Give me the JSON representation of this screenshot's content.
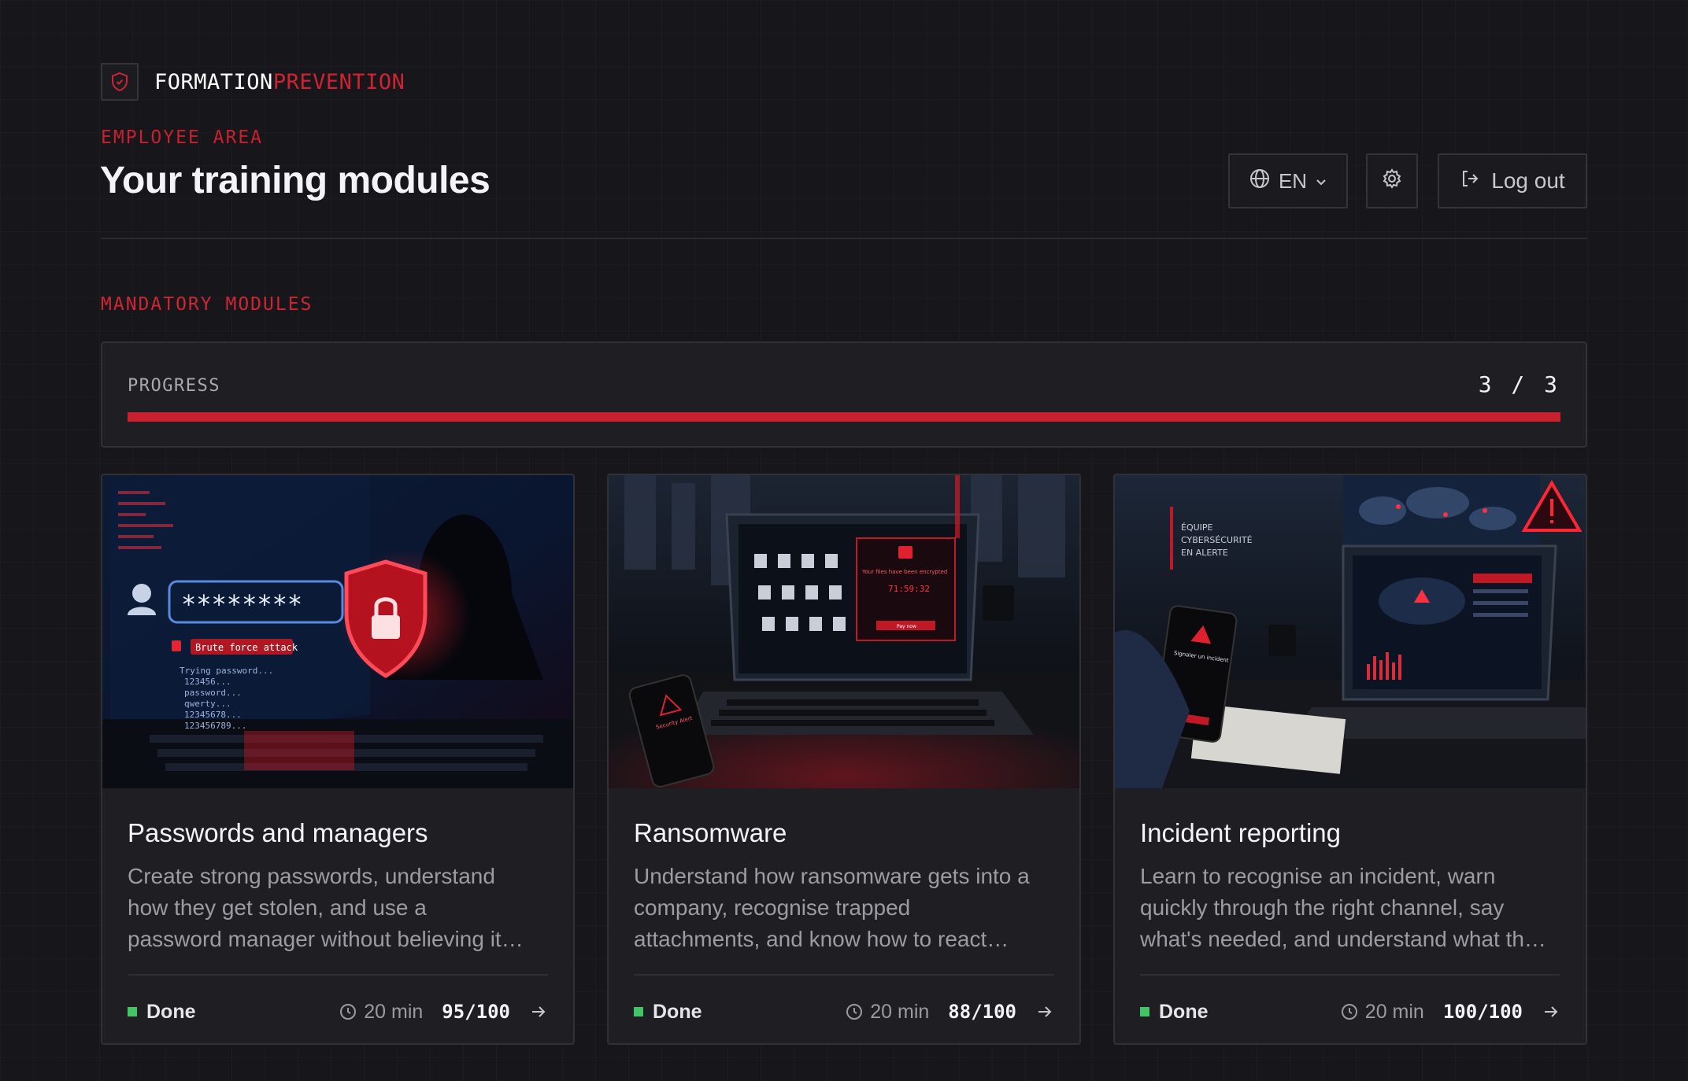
{
  "brand": {
    "part1": "FORMATION",
    "part2": "PREVENTION",
    "icon": "shield-icon"
  },
  "header": {
    "eyebrow": "EMPLOYEE AREA",
    "title": "Your training modules",
    "language": {
      "value": "EN",
      "icon": "globe-icon"
    },
    "settings_icon": "gear-icon",
    "logout_label": "Log out"
  },
  "section": {
    "label": "MANDATORY MODULES"
  },
  "progress": {
    "label": "PROGRESS",
    "count": "3 / 3",
    "completed": 3,
    "total": 3
  },
  "colors": {
    "accent": "#c8202f",
    "done": "#43c466",
    "background": "#17171b"
  },
  "modules": [
    {
      "title": "Passwords and managers",
      "desc_lines": [
        "Create strong passwords, understand",
        "how they get stolen, and use a",
        "password manager without believing it…"
      ],
      "status": "Done",
      "duration": "20 min",
      "score": "95/100",
      "image_text": {
        "password": "********",
        "alert": "Brute force attack",
        "log": [
          "Trying password...",
          "123456...",
          "password...",
          "qwerty...",
          "12345678...",
          "123456789..."
        ]
      }
    },
    {
      "title": "Ransomware",
      "desc_lines": [
        "Understand how ransomware gets into a",
        "company, recognise trapped",
        "attachments, and know how to react…"
      ],
      "status": "Done",
      "duration": "20 min",
      "score": "88/100",
      "image_text": {
        "screen_title": "Your files have been encrypted",
        "timer": "71:59:32",
        "pay": "Pay now",
        "phone": "Security Alert"
      }
    },
    {
      "title": "Incident reporting",
      "desc_lines": [
        "Learn to recognise an incident, warn",
        "quickly through the right channel, say",
        "what's needed, and understand what th…"
      ],
      "status": "Done",
      "duration": "20 min",
      "score": "100/100",
      "image_text": {
        "banner": [
          "ÉQUIPE",
          "CYBERSÉCURITÉ",
          "EN ALERTE"
        ],
        "phone": "Signaler un incident"
      }
    }
  ]
}
